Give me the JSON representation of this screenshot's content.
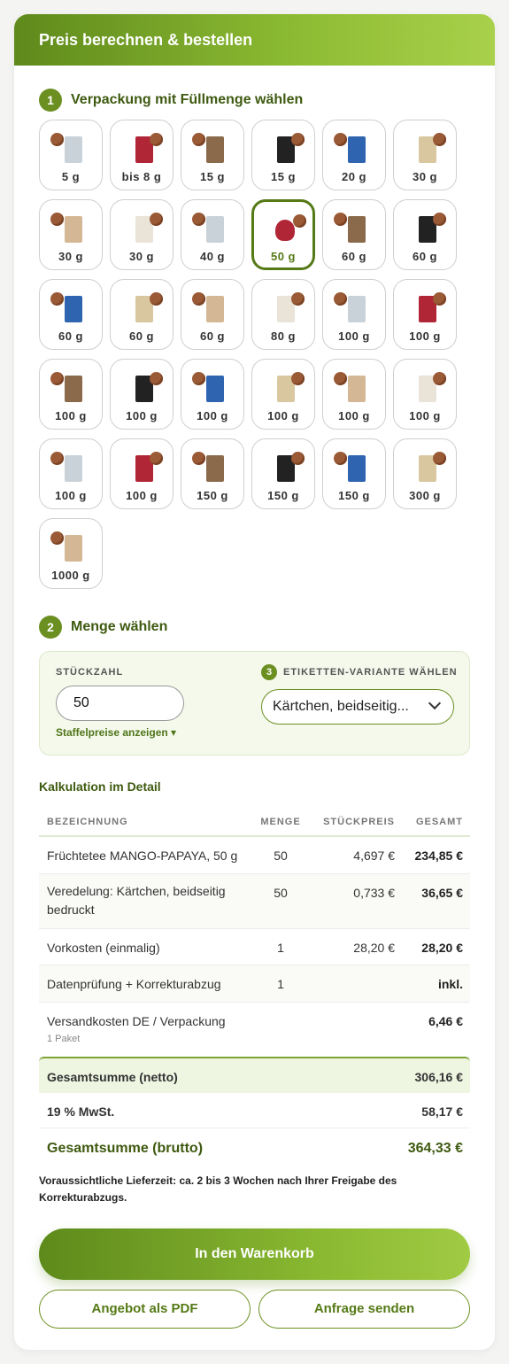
{
  "header": {
    "title": "Preis berechnen & bestellen"
  },
  "step1": {
    "num": "1",
    "title": "Verpackung mit Füllmenge wählen"
  },
  "packaging": [
    {
      "label": "5 g"
    },
    {
      "label": "bis 8 g"
    },
    {
      "label": "15 g"
    },
    {
      "label": "15 g"
    },
    {
      "label": "20 g"
    },
    {
      "label": "30 g"
    },
    {
      "label": "30 g"
    },
    {
      "label": "30 g"
    },
    {
      "label": "40 g"
    },
    {
      "label": "50 g",
      "selected": true
    },
    {
      "label": "60 g"
    },
    {
      "label": "60 g"
    },
    {
      "label": "60 g"
    },
    {
      "label": "60 g"
    },
    {
      "label": "60 g"
    },
    {
      "label": "80 g"
    },
    {
      "label": "100 g"
    },
    {
      "label": "100 g"
    },
    {
      "label": "100 g"
    },
    {
      "label": "100 g"
    },
    {
      "label": "100 g"
    },
    {
      "label": "100 g"
    },
    {
      "label": "100 g"
    },
    {
      "label": "100 g"
    },
    {
      "label": "100 g"
    },
    {
      "label": "100 g"
    },
    {
      "label": "150 g"
    },
    {
      "label": "150 g"
    },
    {
      "label": "150 g"
    },
    {
      "label": "300 g"
    },
    {
      "label": "1000 g"
    }
  ],
  "step2": {
    "num": "2",
    "title": "Menge wählen"
  },
  "quantity": {
    "label": "STÜCKZAHL",
    "value": "50",
    "staffel_link": "Staffelpreise anzeigen ▾"
  },
  "step3": {
    "num": "3",
    "label": "ETIKETTEN-VARIANTE WÄHLEN",
    "selected": "Kärtchen, beidseitig..."
  },
  "kalkulation": {
    "title": "Kalkulation im Detail",
    "headers": [
      "BEZEICHNUNG",
      "MENGE",
      "STÜCKPREIS",
      "GESAMT"
    ],
    "rows": [
      {
        "name": "Früchtetee MANGO-PAPAYA, 50 g",
        "qty": "50",
        "unit": "4,697 €",
        "total": "234,85 €"
      },
      {
        "name": "Veredelung: Kärtchen, beidseitig bedruckt",
        "qty": "50",
        "unit": "0,733 €",
        "total": "36,65 €"
      },
      {
        "name": "Vorkosten (einmalig)",
        "qty": "1",
        "unit": "28,20 €",
        "total": "28,20 €"
      },
      {
        "name": "Datenprüfung + Korrekturabzug",
        "qty": "1",
        "unit": "",
        "total": "inkl."
      },
      {
        "name": "Versandkosten DE / Verpackung",
        "sub": "1 Paket",
        "qty": "",
        "unit": "",
        "total": "6,46 €"
      }
    ],
    "net_label": "Gesamtsumme (netto)",
    "net_value": "306,16 €",
    "vat_label": "19 % MwSt.",
    "vat_value": "58,17 €",
    "gross_label": "Gesamtsumme (brutto)",
    "gross_value": "364,33 €"
  },
  "lieferzeit": "Voraussichtliche Lieferzeit: ca. 2 bis 3 Wochen nach Ihrer Freigabe des Korrekturabzugs.",
  "buttons": {
    "cart": "In den Warenkorb",
    "pdf": "Angebot als PDF",
    "request": "Anfrage senden"
  },
  "colors": {
    "brand": "#6b8f21",
    "brand_light": "#a9d04a"
  }
}
